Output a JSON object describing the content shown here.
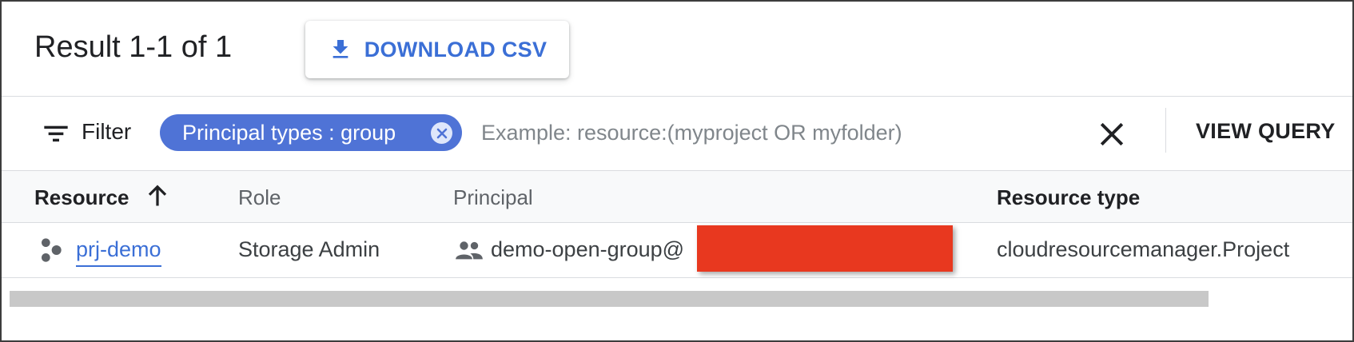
{
  "header": {
    "result_text": "Result 1-1 of 1",
    "download_label": "DOWNLOAD CSV"
  },
  "filter": {
    "label": "Filter",
    "chip_label": "Principal types : group",
    "input_value": "",
    "input_placeholder": "Example: resource:(myproject OR myfolder)",
    "view_query_label": "VIEW QUERY"
  },
  "table": {
    "columns": [
      "Resource",
      "Role",
      "Principal",
      "Resource type"
    ],
    "sort": {
      "column": "Resource",
      "direction": "ascending"
    },
    "rows": [
      {
        "resource": "prj-demo",
        "role": "Storage Admin",
        "principal": "demo-open-group@",
        "resource_type": "cloudresourcemanager.Project"
      }
    ]
  },
  "icons": {
    "download": "download-icon",
    "filter": "filter-icon",
    "chip_close": "chip-close-icon",
    "clear": "close-icon",
    "sort": "arrow-up-icon",
    "resource": "project-icon",
    "principal": "group-icon"
  },
  "colors": {
    "accent": "#3b6fd6",
    "chip": "#4f73d6",
    "redaction": "#e8381f"
  }
}
